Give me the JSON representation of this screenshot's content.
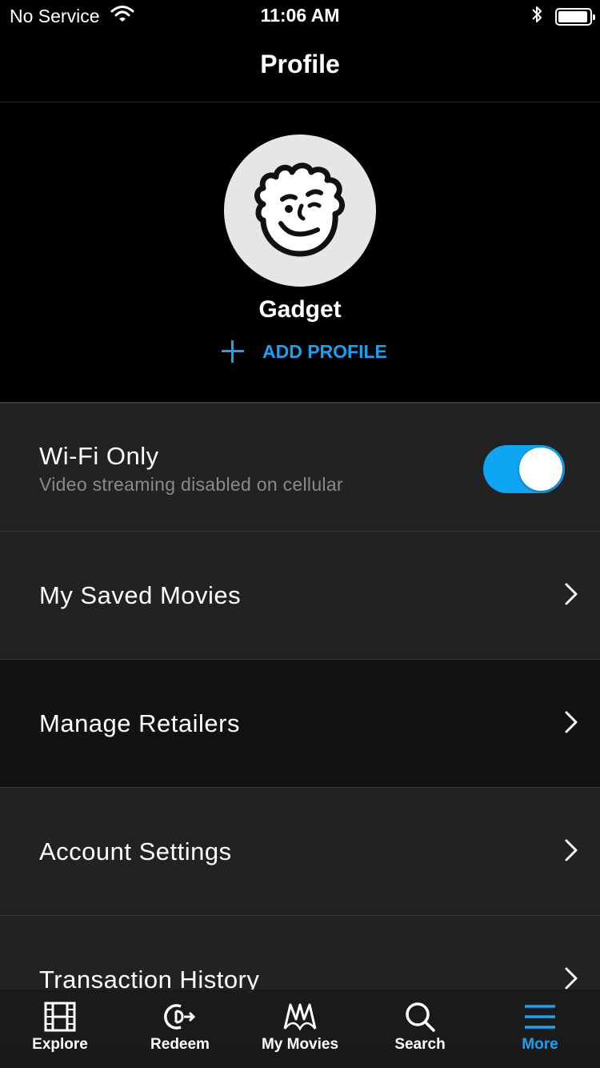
{
  "status_bar": {
    "carrier": "No Service",
    "time": "11:06 AM",
    "battery_level": 0.95
  },
  "header": {
    "title": "Profile"
  },
  "profile": {
    "name": "Gadget",
    "add_profile_label": "ADD PROFILE"
  },
  "settings": {
    "wifi": {
      "label": "Wi-Fi Only",
      "subtitle": "Video streaming disabled on cellular",
      "enabled": true
    },
    "items": [
      {
        "label": "My Saved Movies"
      },
      {
        "label": "Manage Retailers"
      },
      {
        "label": "Account Settings"
      },
      {
        "label": "Transaction History"
      }
    ]
  },
  "tab_bar": {
    "tabs": [
      {
        "label": "Explore",
        "icon": "film-icon"
      },
      {
        "label": "Redeem",
        "icon": "redeem-icon"
      },
      {
        "label": "My Movies",
        "icon": "movies-logo-icon"
      },
      {
        "label": "Search",
        "icon": "search-icon"
      },
      {
        "label": "More",
        "icon": "menu-icon",
        "active": true
      }
    ]
  },
  "colors": {
    "accent": "#1aa0f0",
    "toggle_on": "#0ea5f5",
    "row_bg": "#222222",
    "row_bg_highlight": "#121212"
  }
}
